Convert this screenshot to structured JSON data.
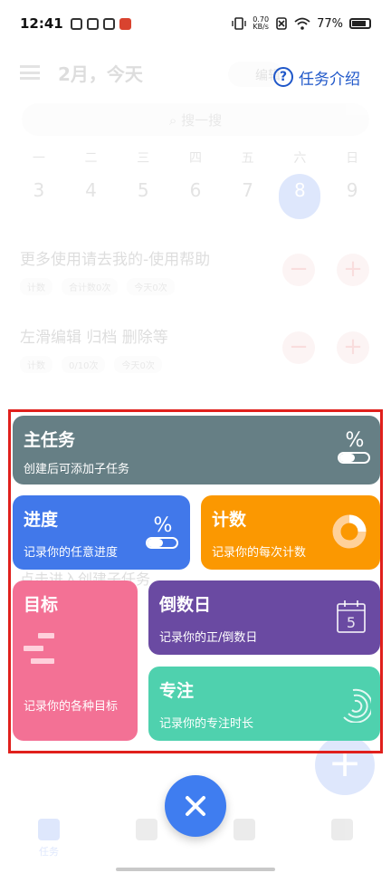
{
  "status_bar": {
    "time": "12:41",
    "net_speed_value": "0.70",
    "net_speed_unit": "KB/s",
    "battery": "77%"
  },
  "background": {
    "header_title": "2月，今天",
    "edit_label": "编辑",
    "search_placeholder": "搜一搜",
    "weekdays": [
      "一",
      "二",
      "三",
      "四",
      "五",
      "六",
      "日"
    ],
    "dates": [
      "3",
      "4",
      "5",
      "6",
      "7",
      "8",
      "9"
    ],
    "tasks": [
      {
        "title": "更多使用请去我的-使用帮助",
        "tags": [
          "计数",
          "合计数0次",
          "今天0次"
        ]
      },
      {
        "title": "左滑编辑 归档 删除等",
        "tags": [
          "计数",
          "0/10次",
          "今天0次"
        ]
      }
    ],
    "hint_text": "点击进入创建子任务",
    "nav": {
      "tasks_label": "任务"
    }
  },
  "help_link": {
    "icon": "question-circle-icon",
    "label": "任务介绍"
  },
  "cards": {
    "main": {
      "title": "主任务",
      "desc": "创建后可添加子任务",
      "icon": "percent-toggle-icon",
      "color": "#667f85"
    },
    "progress": {
      "title": "进度",
      "desc": "记录你的任意进度",
      "icon": "percent-toggle-icon",
      "color": "#4178ea"
    },
    "count": {
      "title": "计数",
      "desc": "记录你的每次计数",
      "icon": "donut-chart-icon",
      "color": "#fb9801"
    },
    "goal": {
      "title": "目标",
      "desc": "记录你的各种目标",
      "icon": "gantt-bars-icon",
      "color": "#f37195"
    },
    "countdown": {
      "title": "倒数日",
      "desc": "记录你的正/倒数日",
      "icon": "calendar-icon",
      "calendar_day": "5",
      "color": "#6a4aa2"
    },
    "focus": {
      "title": "专注",
      "desc": "记录你的专注时长",
      "icon": "concentric-arcs-icon",
      "color": "#4fd1ae"
    }
  },
  "close_button": {
    "icon": "close-icon",
    "color": "#3f7df0"
  },
  "colors": {
    "highlight_frame": "#e0201c",
    "accent": "#1f57c9"
  }
}
